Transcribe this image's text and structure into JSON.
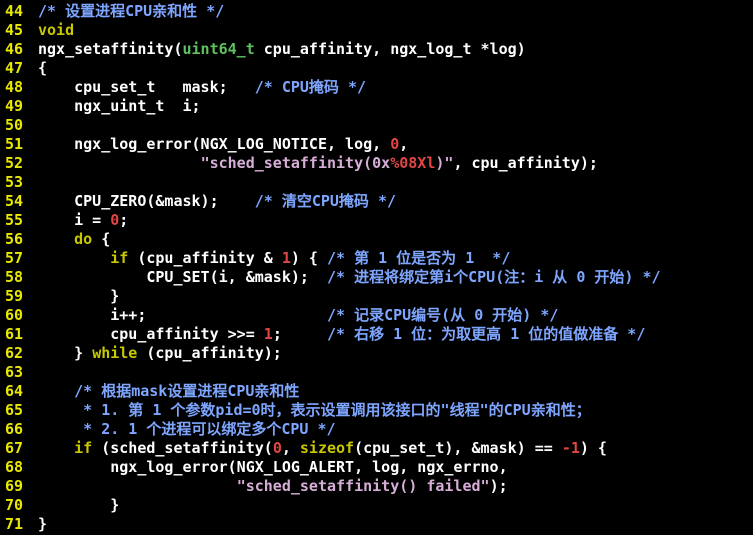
{
  "colors": {
    "background": "#000000",
    "line_number": "#e8e800",
    "keyword": "#c8c800",
    "type": "#5ec25e",
    "number": "#e04646",
    "string": "#d7aed7",
    "comment": "#7ea6ff",
    "text": "#ffffff"
  },
  "lines": [
    {
      "n": "44",
      "t": [
        [
          "cm",
          "/* 设置进程CPU亲和性 */"
        ]
      ]
    },
    {
      "n": "45",
      "t": [
        [
          "kw",
          "void"
        ]
      ]
    },
    {
      "n": "46",
      "t": [
        [
          "txt",
          "ngx_setaffinity("
        ],
        [
          "type",
          "uint64_t"
        ],
        [
          "txt",
          " cpu_affinity, ngx_log_t *log)"
        ]
      ]
    },
    {
      "n": "47",
      "t": [
        [
          "txt",
          "{"
        ]
      ]
    },
    {
      "n": "48",
      "t": [
        [
          "txt",
          "    cpu_set_t   mask;   "
        ],
        [
          "cm",
          "/* CPU掩码 */"
        ]
      ]
    },
    {
      "n": "49",
      "t": [
        [
          "txt",
          "    ngx_uint_t  i;"
        ]
      ]
    },
    {
      "n": "50",
      "t": []
    },
    {
      "n": "51",
      "t": [
        [
          "txt",
          "    ngx_log_error(NGX_LOG_NOTICE, log, "
        ],
        [
          "num",
          "0"
        ],
        [
          "txt",
          ","
        ]
      ]
    },
    {
      "n": "52",
      "t": [
        [
          "txt",
          "                  "
        ],
        [
          "str",
          "\"sched_setaffinity(0x"
        ],
        [
          "num",
          "%08Xl"
        ],
        [
          "str",
          ")\""
        ],
        [
          "txt",
          ", cpu_affinity);"
        ]
      ]
    },
    {
      "n": "53",
      "t": []
    },
    {
      "n": "54",
      "t": [
        [
          "txt",
          "    CPU_ZERO(&mask);    "
        ],
        [
          "cm",
          "/* 清空CPU掩码 */"
        ]
      ]
    },
    {
      "n": "55",
      "t": [
        [
          "txt",
          "    i = "
        ],
        [
          "num",
          "0"
        ],
        [
          "txt",
          ";"
        ]
      ]
    },
    {
      "n": "56",
      "t": [
        [
          "txt",
          "    "
        ],
        [
          "kw",
          "do"
        ],
        [
          "txt",
          " {"
        ]
      ]
    },
    {
      "n": "57",
      "t": [
        [
          "txt",
          "        "
        ],
        [
          "kw",
          "if"
        ],
        [
          "txt",
          " (cpu_affinity & "
        ],
        [
          "num",
          "1"
        ],
        [
          "txt",
          ") { "
        ],
        [
          "cm",
          "/* 第 1 位是否为 1  */"
        ]
      ]
    },
    {
      "n": "58",
      "t": [
        [
          "txt",
          "            CPU_SET(i, &mask);  "
        ],
        [
          "cm",
          "/* 进程将绑定第i个CPU(注：i 从 0 开始) */"
        ]
      ]
    },
    {
      "n": "59",
      "t": [
        [
          "txt",
          "        }"
        ]
      ]
    },
    {
      "n": "60",
      "t": [
        [
          "txt",
          "        i++;                    "
        ],
        [
          "cm",
          "/* 记录CPU编号(从 0 开始) */"
        ]
      ]
    },
    {
      "n": "61",
      "t": [
        [
          "txt",
          "        cpu_affinity >>= "
        ],
        [
          "num",
          "1"
        ],
        [
          "txt",
          ";     "
        ],
        [
          "cm",
          "/* 右移 1 位：为取更高 1 位的值做准备 */"
        ]
      ]
    },
    {
      "n": "62",
      "t": [
        [
          "txt",
          "    } "
        ],
        [
          "kw",
          "while"
        ],
        [
          "txt",
          " (cpu_affinity);"
        ]
      ]
    },
    {
      "n": "63",
      "t": []
    },
    {
      "n": "64",
      "t": [
        [
          "txt",
          "    "
        ],
        [
          "cm",
          "/* 根据mask设置进程CPU亲和性"
        ]
      ]
    },
    {
      "n": "65",
      "t": [
        [
          "cm",
          "     * 1. 第 1 个参数pid=0时，表示设置调用该接口的\"线程\"的CPU亲和性；"
        ]
      ]
    },
    {
      "n": "66",
      "t": [
        [
          "cm",
          "     * 2. 1 个进程可以绑定多个CPU */"
        ]
      ]
    },
    {
      "n": "67",
      "t": [
        [
          "txt",
          "    "
        ],
        [
          "kw",
          "if"
        ],
        [
          "txt",
          " (sched_setaffinity("
        ],
        [
          "num",
          "0"
        ],
        [
          "txt",
          ", "
        ],
        [
          "kw",
          "sizeof"
        ],
        [
          "txt",
          "(cpu_set_t), &mask) == "
        ],
        [
          "num",
          "-1"
        ],
        [
          "txt",
          ") {"
        ]
      ]
    },
    {
      "n": "68",
      "t": [
        [
          "txt",
          "        ngx_log_error(NGX_LOG_ALERT, log, ngx_errno,"
        ]
      ]
    },
    {
      "n": "69",
      "t": [
        [
          "txt",
          "                      "
        ],
        [
          "str",
          "\"sched_setaffinity() failed\""
        ],
        [
          "txt",
          ");"
        ]
      ]
    },
    {
      "n": "70",
      "t": [
        [
          "txt",
          "        }"
        ]
      ]
    },
    {
      "n": "71",
      "t": [
        [
          "txt",
          "}"
        ]
      ]
    }
  ]
}
